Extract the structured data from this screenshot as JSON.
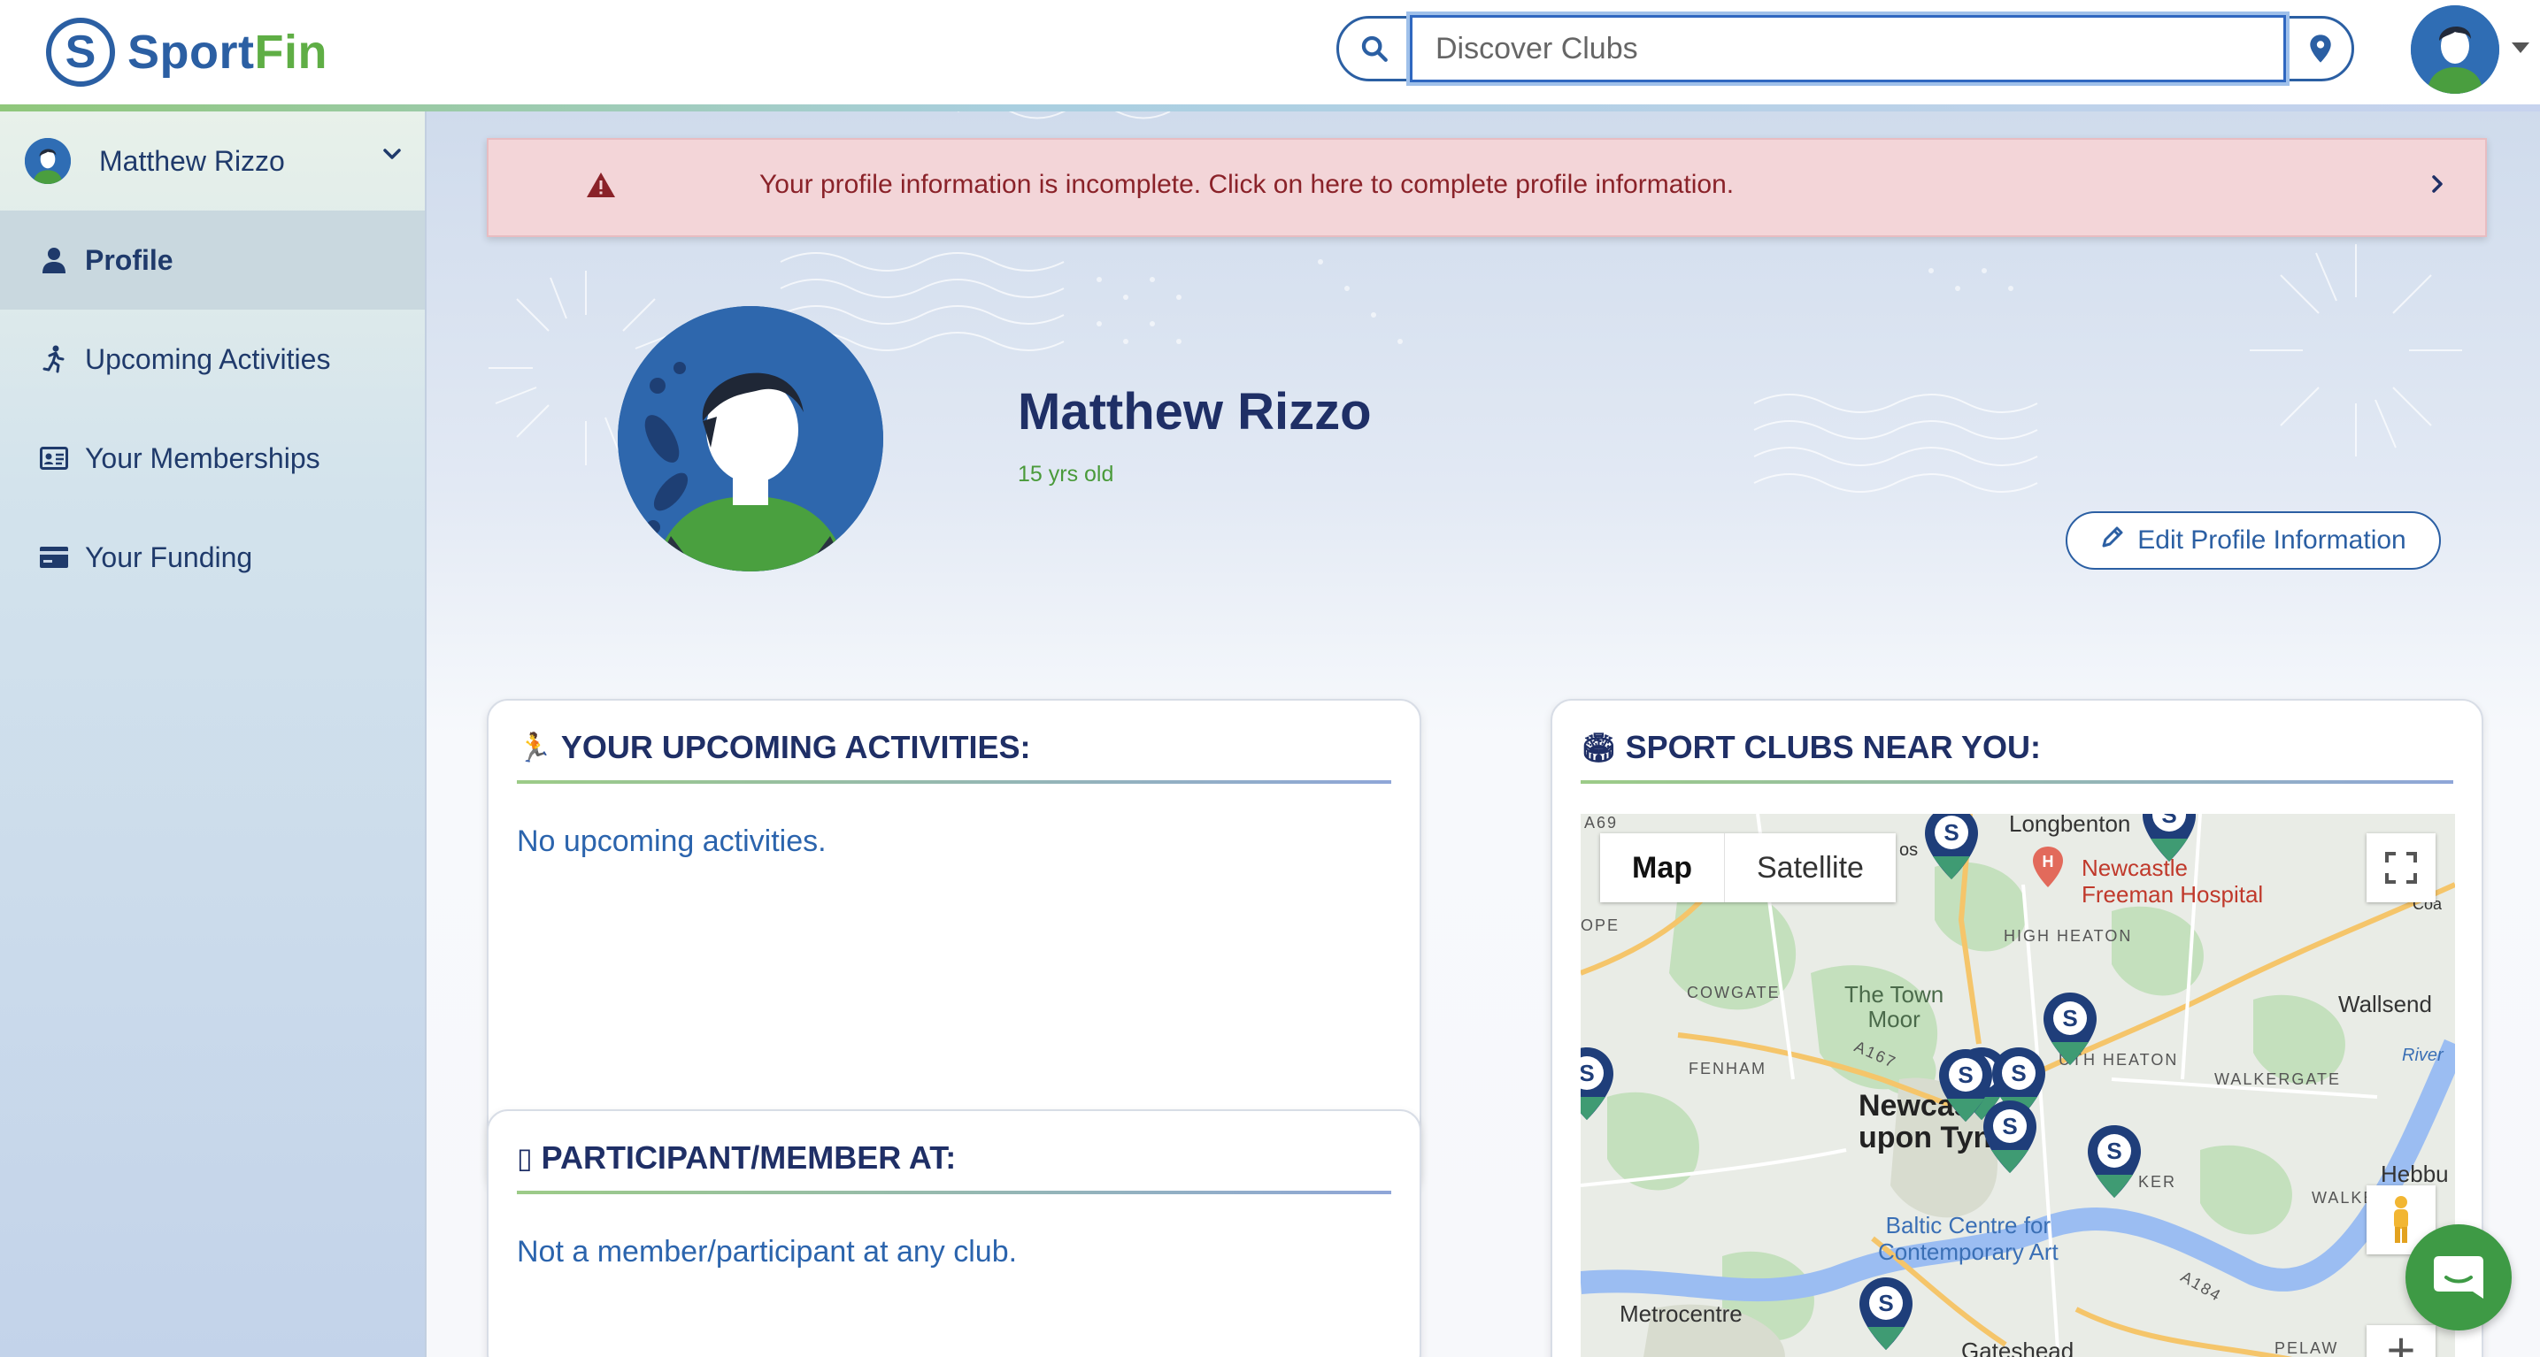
{
  "app": {
    "name_part1": "Sport",
    "name_part2": "Fin",
    "logo_letter": "S"
  },
  "search": {
    "placeholder": "Discover Clubs",
    "value": ""
  },
  "sidebar": {
    "user_name": "Matthew Rizzo",
    "items": [
      {
        "label": "Profile",
        "icon": "user-icon",
        "active": true
      },
      {
        "label": "Upcoming Activities",
        "icon": "running-icon",
        "active": false
      },
      {
        "label": "Your Memberships",
        "icon": "id-card-icon",
        "active": false
      },
      {
        "label": "Your Funding",
        "icon": "credit-card-icon",
        "active": false
      }
    ]
  },
  "alert": {
    "text": "Your profile information is incomplete. Click on here to complete profile information.",
    "color": "#8a2229"
  },
  "profile": {
    "name": "Matthew Rizzo",
    "age": "15 yrs old",
    "edit_label": "Edit Profile Information"
  },
  "upcoming_card": {
    "emoji": "🏃",
    "title": "YOUR UPCOMING ACTIVITIES:",
    "empty_text": "No upcoming activities."
  },
  "member_card": {
    "emoji": "▯",
    "title": "PARTICIPANT/MEMBER AT:",
    "empty_text": "Not a member/participant at any club."
  },
  "clubs_card": {
    "emoji": "🏟",
    "title": "SPORT CLUBS NEAR YOU:"
  },
  "map": {
    "toggle_map": "Map",
    "toggle_satellite": "Satellite",
    "zoom_in": "+",
    "labels": {
      "longbenton": "Longbenton",
      "hospital1": "Newcastle",
      "hospital2": "Freeman Hospital",
      "high_heaton": "HIGH HEATON",
      "cowgate": "COWGATE",
      "town_moor1": "The Town",
      "town_moor2": "Moor",
      "wallsend": "Wallsend",
      "fenham": "FENHAM",
      "a167": "A167",
      "heaton": "UTH HEATON",
      "walkergate": "WALKERGATE",
      "river": "River",
      "newcastle1": "Newcas",
      "newcastle2": "upon Tyne",
      "hebburn": "Hebbu",
      "walker": "WALKER",
      "ker": "KER",
      "baltic1": "Baltic Centre for",
      "baltic2": "Contemporary Art",
      "a184": "A184",
      "metrocentre": "Metrocentre",
      "gateshead": "Gateshead",
      "pelaw": "PELAW",
      "ope": "OPE",
      "os": "os",
      "coa": "Coa",
      "a69": "A69"
    }
  },
  "colors": {
    "brand_blue": "#2b5fa3",
    "brand_green": "#5fae45",
    "alert_bg": "#f3d5d8",
    "chat_green": "#3e9a45"
  }
}
